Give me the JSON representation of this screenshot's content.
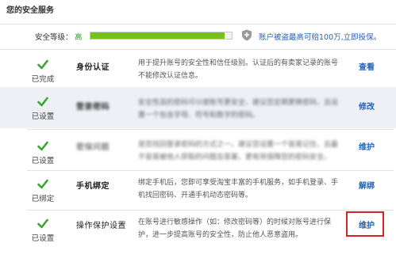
{
  "page": {
    "title": "您的安全服务"
  },
  "security_level": {
    "label": "安全等级：",
    "value": "高",
    "progress": 0.95,
    "promo_text": "账户被盗最高可赔100万,立即投保。"
  },
  "colors": {
    "accent": "#2463b6",
    "progress": "#76c01f",
    "check": "#3aa62f",
    "highlight": "#d0262a"
  },
  "rows": [
    {
      "status": "已完成",
      "name": "身份认证",
      "desc": "用于提升账号的安全性和信任级别。认证后的有卖家记录的账号不能修改认证信息。",
      "action": "查看"
    },
    {
      "status": "已设置",
      "name": "登录密码",
      "desc": "安全性高的密码可以使账号更安全，建议您定期更换密码，且设置一个包含字母、符号和数字的密码。",
      "action": "修改"
    },
    {
      "status": "已设置",
      "name": "密保问题",
      "desc": "是您找回登录密码的方式之一。建议您设置一个容易记住，且最不容易被他人获取的问题及答案，更有效保障您的密码安全。",
      "action": "维护"
    },
    {
      "status": "已绑定",
      "name": "手机绑定",
      "desc": "绑定手机后，您即可享受淘宝丰富的手机服务，如手机登录、手机找回密码、开通手机动态密码等。",
      "action": "解绑"
    },
    {
      "status": "已设置",
      "name": "操作保护设置",
      "desc": "在账号进行敏感操作（如：修改密码等）的时候对账号进行保护，进一步提高账号的安全性，防止他人恶意盗用。",
      "action": "维护"
    }
  ]
}
